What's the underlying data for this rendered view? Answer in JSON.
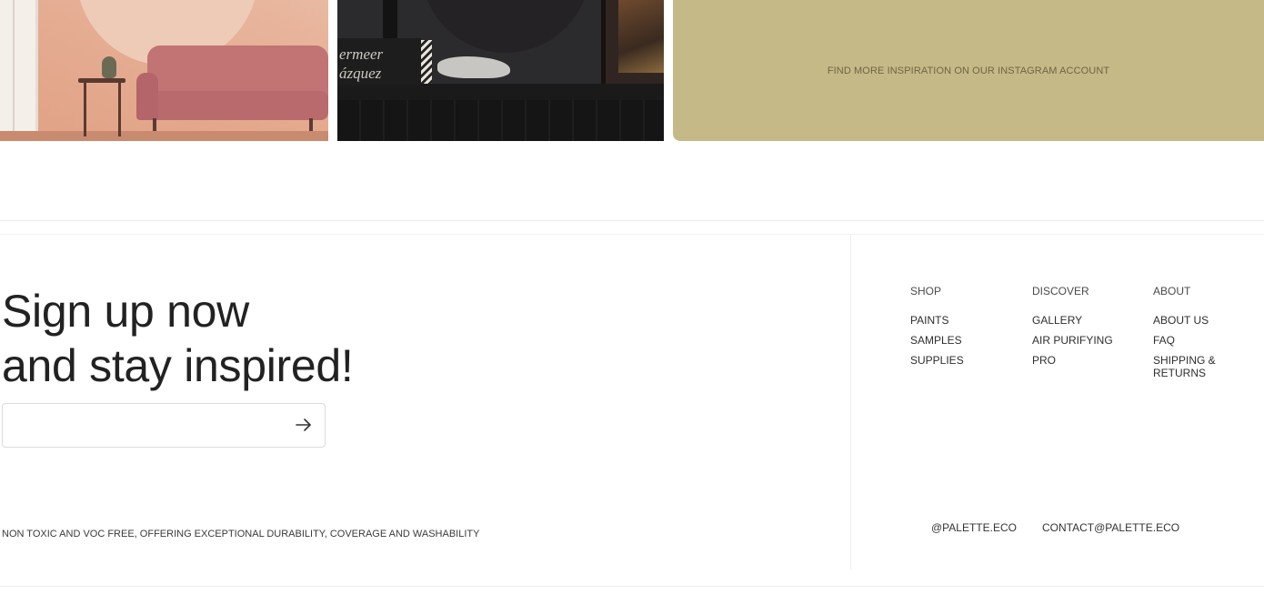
{
  "gallery": {
    "tile1_alt": "",
    "tile2_book_lines": [
      "ermeer",
      "ázquez"
    ],
    "instagram_link": "FIND MORE INSPIRATION ON OUR INSTAGRAM ACCOUNT"
  },
  "signup": {
    "title_line1": "Sign up now",
    "title_line2": "and stay inspired!",
    "email_value": "",
    "email_placeholder": "",
    "submit_icon": "arrow-right-icon"
  },
  "tagline": "NON TOXIC AND VOC FREE, OFFERING EXCEPTIONAL DURABILITY, COVERAGE AND WASHABILITY",
  "nav": {
    "shop": {
      "heading": "SHOP",
      "links": [
        "PAINTS",
        "SAMPLES",
        "SUPPLIES"
      ]
    },
    "discover": {
      "heading": "DISCOVER",
      "links": [
        "GALLERY",
        "AIR PURIFYING",
        "PRO"
      ]
    },
    "about": {
      "heading": "ABOUT",
      "links": [
        "ABOUT US",
        "FAQ",
        "SHIPPING & RETURNS"
      ]
    }
  },
  "contact": {
    "instagram": "@PALETTE.ECO",
    "email": "CONTACT@PALETTE.ECO"
  },
  "colors": {
    "instagram_tile": "#c6b988",
    "text": "#222222",
    "divider": "#ededed"
  }
}
